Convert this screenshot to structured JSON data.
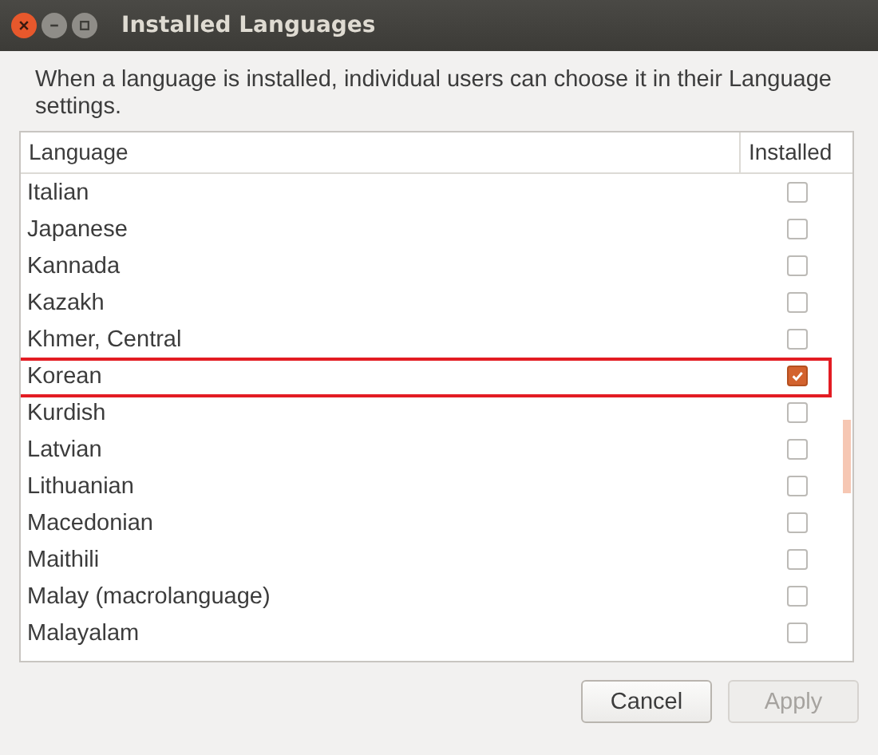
{
  "window": {
    "title": "Installed Languages"
  },
  "description": "When a language is installed, individual users can choose it in their Language settings.",
  "table": {
    "columns": [
      "Language",
      "Installed"
    ],
    "rows": [
      {
        "language": "Italian",
        "installed": false,
        "highlighted": false
      },
      {
        "language": "Japanese",
        "installed": false,
        "highlighted": false
      },
      {
        "language": "Kannada",
        "installed": false,
        "highlighted": false
      },
      {
        "language": "Kazakh",
        "installed": false,
        "highlighted": false
      },
      {
        "language": "Khmer, Central",
        "installed": false,
        "highlighted": false
      },
      {
        "language": "Korean",
        "installed": true,
        "highlighted": true
      },
      {
        "language": "Kurdish",
        "installed": false,
        "highlighted": false
      },
      {
        "language": "Latvian",
        "installed": false,
        "highlighted": false
      },
      {
        "language": "Lithuanian",
        "installed": false,
        "highlighted": false
      },
      {
        "language": "Macedonian",
        "installed": false,
        "highlighted": false
      },
      {
        "language": "Maithili",
        "installed": false,
        "highlighted": false
      },
      {
        "language": "Malay (macrolanguage)",
        "installed": false,
        "highlighted": false
      },
      {
        "language": "Malayalam",
        "installed": false,
        "highlighted": false
      }
    ]
  },
  "buttons": [
    {
      "label": "Cancel",
      "disabled": false
    },
    {
      "label": "Apply",
      "disabled": true
    }
  ]
}
